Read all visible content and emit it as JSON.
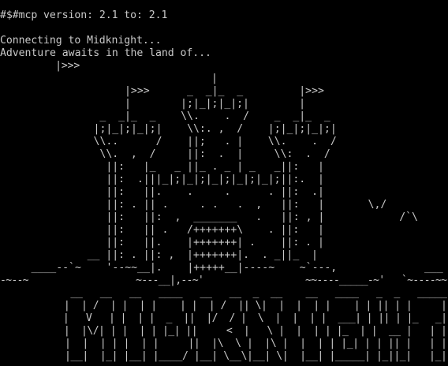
{
  "terminal": {
    "header": [
      "#$#mcp version: 2.1 to: 2.1",
      "",
      "Connecting to Midknight...",
      "Adventure awaits in the land of...",
      "         |>>>"
    ],
    "castle": [
      "                                  |",
      "                    |>>>      _  _|_  _         |>>>",
      "                    |        |;|_|;|_|;|        |",
      "                _  _|_  _    \\\\.    .  /    _  _|_  _",
      "               |;|_|;|_|;|    \\\\:. ,  /    |;|_|;|_|;|",
      "               \\\\..      /    ||;   . |    \\\\.    .  /",
      "                \\\\.  ,  /     ||:  .  |     \\\\:  .  /",
      "                 ||:   |_   _ ||_ . _ | _   _||:   |",
      "                 ||:  .|||_|;|_|;|_|;|_|;|_|;||:.  |",
      "                 ||:   ||.    .     .      . ||:  .|",
      "                 ||: . || .     . .   .  ,   ||:   |       \\,/",
      "                 ||:   ||:  ,  _______   .   ||: , |            /`\\",
      "                 ||:   || .   /+++++++\\    . ||:   |",
      "                 ||:   ||.    |+++++++| .    ||: . |",
      "              __ ||: . ||: ,  |+++++++|.  . _||_  |",
      "     ____--`~    '--~~__|.    |+++++__|----~    ~`---,              ___",
      "-~--~                   ~---__|,--~'                  ~~----_____-~'   `~----~~"
    ],
    "logo": [
      "            __   __   __   ____   __   __  _  __    __   ____   _  _   _____",
      "           |  | /  | |  | |    | |  | /  || \\|  |  |  | |    | | || | |     |",
      "           |   V   | |  | |  _  ||  |/  / |  \\  |  |  | |  ___| | || | |_   _|",
      "           |  |\\/| | |  | | |_| ||     <  |   \\ |  |  | | |_  | |  __ |   | |",
      "           |  |  | | |  | |     ||  |\\  \\ |  |\\ |  |  | | |_| | | || |   | |",
      "           |__|  |_| |__| |____/ |__| \\__\\|__| \\|  |__| |_____| |_||_|   |_|"
    ],
    "rule": "================================================================================"
  }
}
